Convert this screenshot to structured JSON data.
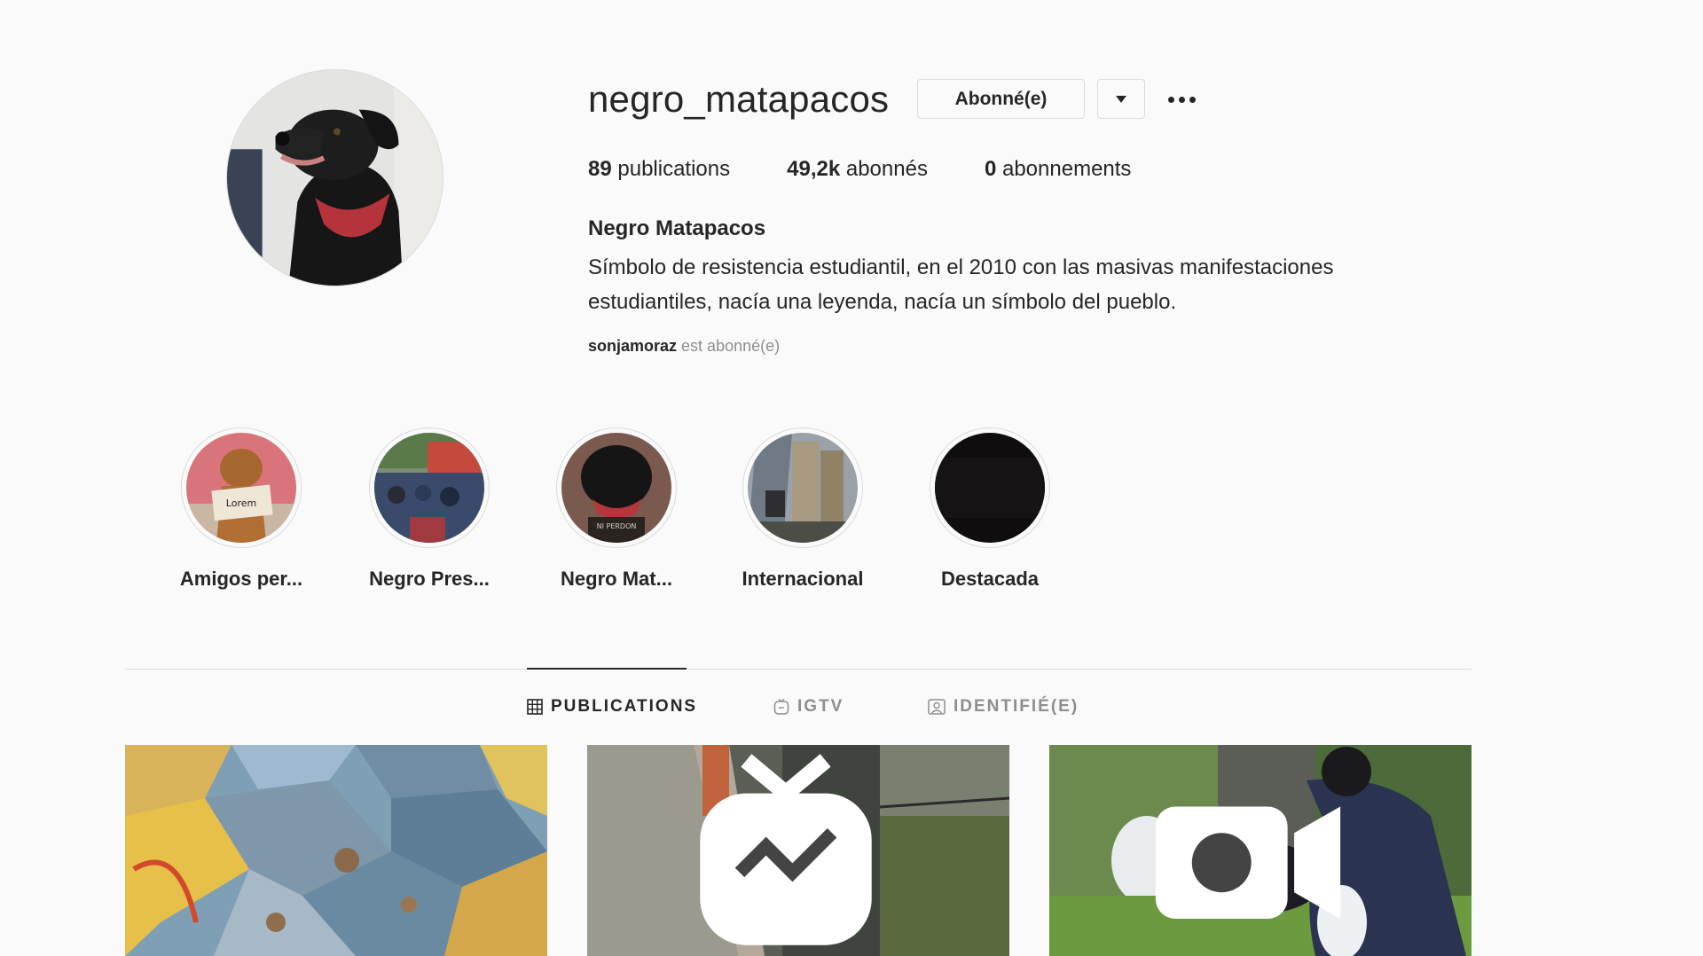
{
  "profile": {
    "username": "negro_matapacos",
    "follow_button": "Abonné(e)",
    "full_name": "Negro Matapacos",
    "bio": "Símbolo de resistencia estudiantil, en el 2010 con las masivas manifestaciones estudiantiles, nacía una leyenda, nacía un símbolo del pueblo.",
    "followed_by_user": "sonjamoraz",
    "followed_by_text": "est abonné(e)"
  },
  "stats": {
    "posts_count": "89",
    "posts_label": "publications",
    "followers_count": "49,2k",
    "followers_label": "abonnés",
    "following_count": "0",
    "following_label": "abonnements"
  },
  "highlights": [
    {
      "label": "Amigos per..."
    },
    {
      "label": "Negro Pres..."
    },
    {
      "label": "Negro Mat..."
    },
    {
      "label": "Internacional"
    },
    {
      "label": "Destacada"
    }
  ],
  "tabs": [
    {
      "label": "PUBLICATIONS",
      "icon": "grid-icon",
      "active": true
    },
    {
      "label": "IGTV",
      "icon": "igtv-icon",
      "active": false
    },
    {
      "label": "IDENTIFIÉ(E)",
      "icon": "tagged-icon",
      "active": false
    }
  ],
  "posts": [
    {
      "icon": "mosaic-image"
    },
    {
      "icon": "igtv-badge-icon"
    },
    {
      "icon": "video-badge-icon"
    }
  ],
  "colors": {
    "background": "#fafafa",
    "text": "#262626",
    "secondary_text": "#8e8e8e",
    "border": "#dbdbdb"
  }
}
